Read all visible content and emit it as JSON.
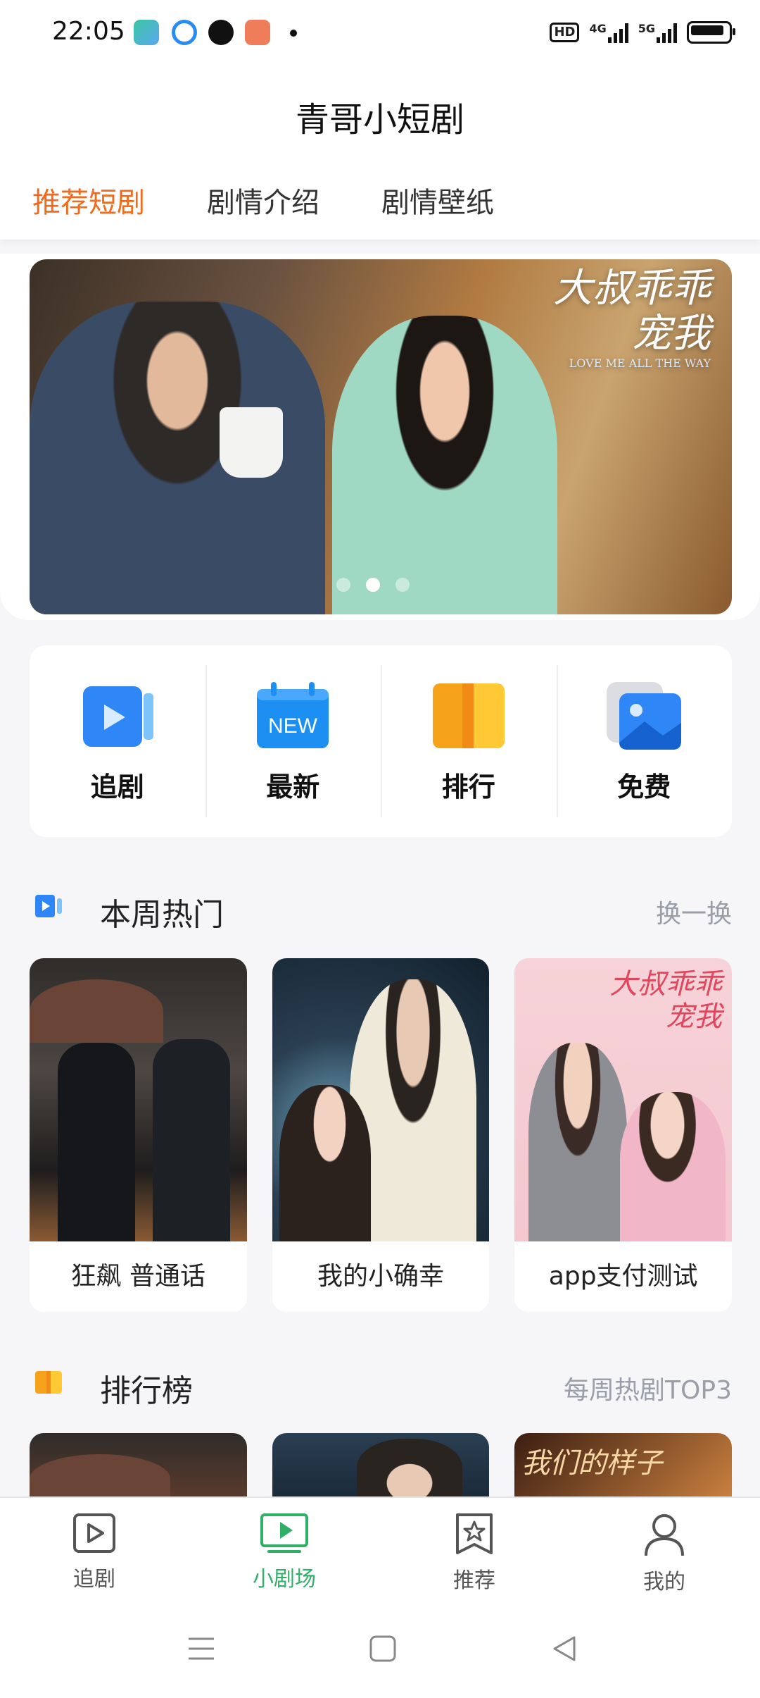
{
  "status_bar": {
    "time": "22:05",
    "hd_label": "HD",
    "net1": "4G",
    "net2": "5G"
  },
  "app_title": "青哥小短剧",
  "tabs": [
    {
      "label": "推荐短剧",
      "active": true
    },
    {
      "label": "剧情介绍",
      "active": false
    },
    {
      "label": "剧情壁纸",
      "active": false
    }
  ],
  "banner": {
    "title_line1": "大叔乖乖",
    "title_line2": "宠我",
    "subtitle": "LOVE ME ALL THE WAY",
    "dots": 3,
    "active_dot": 1
  },
  "quick_actions": [
    {
      "label": "追剧",
      "icon": "play-video-icon"
    },
    {
      "label": "最新",
      "icon": "new-calendar-icon",
      "badge": "NEW"
    },
    {
      "label": "排行",
      "icon": "ranking-icon"
    },
    {
      "label": "免费",
      "icon": "gallery-icon"
    }
  ],
  "hot_section": {
    "title": "本周热门",
    "more": "换一换",
    "items": [
      {
        "title": "狂飙 普通话"
      },
      {
        "title": "我的小确幸"
      },
      {
        "title": "app支付测试"
      }
    ]
  },
  "rank_section": {
    "title": "排行榜",
    "more": "每周热剧TOP3",
    "poster3_text": "我们的样子"
  },
  "bottom_nav": [
    {
      "label": "追剧",
      "icon": "play-square-icon",
      "active": false
    },
    {
      "label": "小剧场",
      "icon": "tv-icon",
      "active": true
    },
    {
      "label": "推荐",
      "icon": "star-bookmark-icon",
      "active": false
    },
    {
      "label": "我的",
      "icon": "user-icon",
      "active": false
    }
  ],
  "colors": {
    "accent_orange": "#f26a1b",
    "accent_green": "#2fb066",
    "icon_blue": "#2f86f6"
  }
}
